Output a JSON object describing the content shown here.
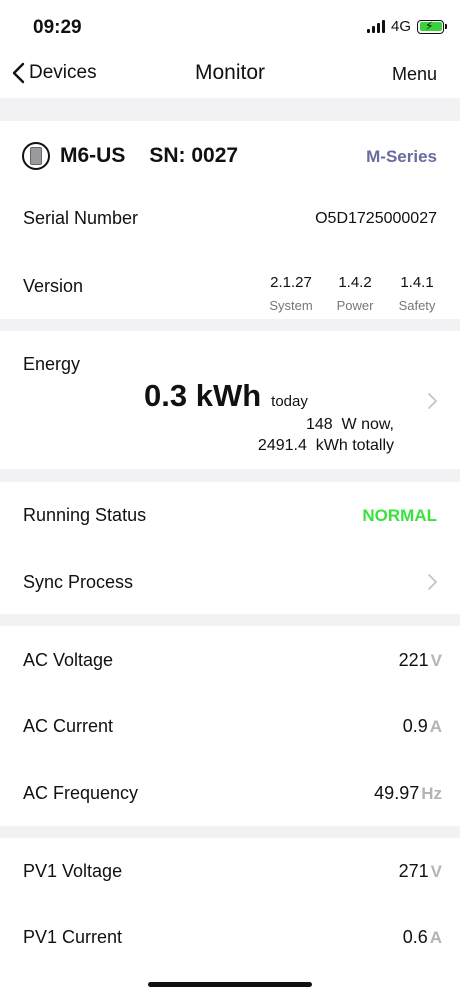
{
  "status_bar": {
    "time": "09:29",
    "network": "4G"
  },
  "nav": {
    "back_label": "Devices",
    "title": "Monitor",
    "menu_label": "Menu"
  },
  "device": {
    "model": "M6-US",
    "sn": "SN: 0027",
    "series": "M-Series",
    "serial_label": "Serial Number",
    "serial_value": "O5D1725000027",
    "version_label": "Version",
    "versions": [
      {
        "value": "2.1.27",
        "label": "System"
      },
      {
        "value": "1.4.2",
        "label": "Power"
      },
      {
        "value": "1.4.1",
        "label": "Safety"
      }
    ]
  },
  "energy": {
    "label": "Energy",
    "today_value": "0.3 kWh",
    "today_suffix": "today",
    "now": "148  W now,",
    "total": "2491.4  kWh totally"
  },
  "running": {
    "status_label": "Running Status",
    "status_value": "NORMAL",
    "status_color": "#3be23b",
    "sync_label": "Sync Process"
  },
  "ac": [
    {
      "label": "AC Voltage",
      "value": "221",
      "unit": "V"
    },
    {
      "label": "AC Current",
      "value": "0.9",
      "unit": "A"
    },
    {
      "label": "AC Frequency",
      "value": "49.97",
      "unit": "Hz"
    }
  ],
  "pv": [
    {
      "label": "PV1 Voltage",
      "value": "271",
      "unit": "V"
    },
    {
      "label": "PV1 Current",
      "value": "0.6",
      "unit": "A"
    }
  ],
  "colors": {
    "accent_series": "#6a6aa0",
    "normal_status": "#3be23b",
    "unit_grey": "#b4b4b8"
  }
}
